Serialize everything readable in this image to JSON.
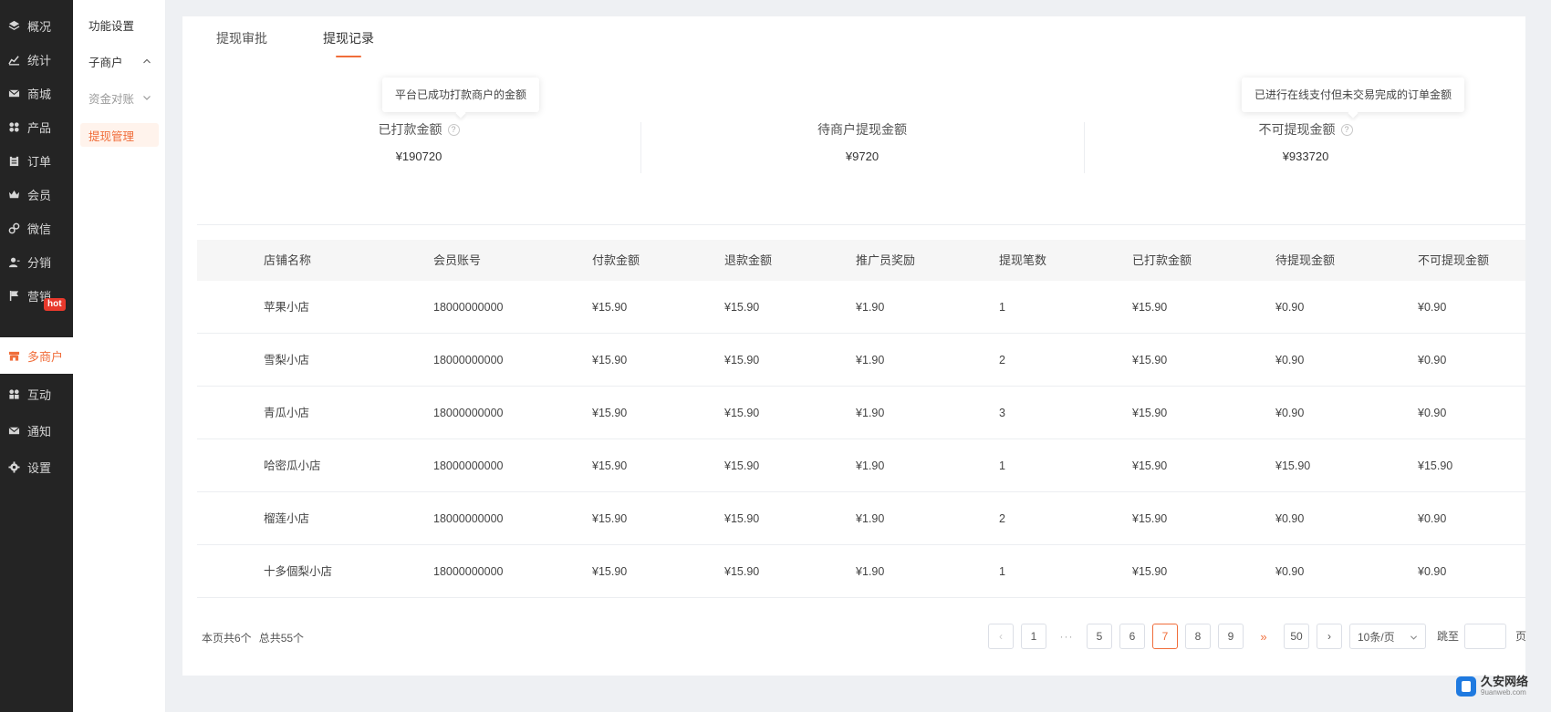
{
  "sidebar": {
    "items": [
      {
        "label": "概况",
        "icon": "layers-icon"
      },
      {
        "label": "统计",
        "icon": "chart-icon"
      },
      {
        "label": "商城",
        "icon": "mail-icon"
      },
      {
        "label": "产品",
        "icon": "grid-icon"
      },
      {
        "label": "订单",
        "icon": "clipboard-icon"
      },
      {
        "label": "会员",
        "icon": "crown-icon"
      },
      {
        "label": "微信",
        "icon": "link-icon"
      },
      {
        "label": "分销",
        "icon": "user-icon"
      },
      {
        "label": "营销",
        "icon": "flag-icon"
      },
      {
        "label": "多商户",
        "icon": "shop-icon"
      },
      {
        "label": "互动",
        "icon": "grid-icon"
      },
      {
        "label": "通知",
        "icon": "mail-icon"
      },
      {
        "label": "设置",
        "icon": "gear-icon"
      }
    ],
    "active_index": 9,
    "hot_badge": "hot"
  },
  "submenu": {
    "items": [
      {
        "label": "功能设置"
      },
      {
        "label": "子商户"
      },
      {
        "label": "资金对账"
      },
      {
        "label": "提现管理"
      }
    ]
  },
  "tabs": [
    {
      "label": "提现审批"
    },
    {
      "label": "提现记录"
    }
  ],
  "stats": [
    {
      "label": "已打款金额",
      "value": "¥190720",
      "tooltip": "平台已成功打款商户的金额"
    },
    {
      "label": "待商户提现金额",
      "value": "¥9720"
    },
    {
      "label": "不可提现金额",
      "value": "¥933720",
      "tooltip": "已进行在线支付但未交易完成的订单金额"
    }
  ],
  "table": {
    "columns": [
      "店铺名称",
      "会员账号",
      "付款金额",
      "退款金额",
      "推广员奖励",
      "提现笔数",
      "已打款金额",
      "待提现金额",
      "不可提现金额"
    ],
    "rows": [
      [
        "苹果小店",
        "18000000000",
        "¥15.90",
        "¥15.90",
        "¥1.90",
        "1",
        "¥15.90",
        "¥0.90",
        "¥0.90"
      ],
      [
        "雪梨小店",
        "18000000000",
        "¥15.90",
        "¥15.90",
        "¥1.90",
        "2",
        "¥15.90",
        "¥0.90",
        "¥0.90"
      ],
      [
        "青瓜小店",
        "18000000000",
        "¥15.90",
        "¥15.90",
        "¥1.90",
        "3",
        "¥15.90",
        "¥0.90",
        "¥0.90"
      ],
      [
        "哈密瓜小店",
        "18000000000",
        "¥15.90",
        "¥15.90",
        "¥1.90",
        "1",
        "¥15.90",
        "¥15.90",
        "¥15.90"
      ],
      [
        "榴莲小店",
        "18000000000",
        "¥15.90",
        "¥15.90",
        "¥1.90",
        "2",
        "¥15.90",
        "¥0.90",
        "¥0.90"
      ],
      [
        "十多個梨小店",
        "18000000000",
        "¥15.90",
        "¥15.90",
        "¥1.90",
        "1",
        "¥15.90",
        "¥0.90",
        "¥0.90"
      ]
    ]
  },
  "footer": {
    "page_count_text": "本页共6个",
    "total_text": "总共55个"
  },
  "pagination": {
    "prev": "‹",
    "first": "1",
    "ellipsis": "···",
    "pages": [
      "5",
      "6",
      "7",
      "8",
      "9"
    ],
    "current": "7",
    "fast_next": "»",
    "last": "50",
    "next": "›",
    "page_size": "10条/页",
    "jump_label": "跳至",
    "jump_suffix": "页",
    "jump_value": ""
  },
  "watermark": {
    "title": "久安网络",
    "subtitle": "9uanweb.com"
  },
  "colors": {
    "accent": "#f06d3a",
    "sidebar_bg": "#242424",
    "badge": "#e8392c"
  }
}
